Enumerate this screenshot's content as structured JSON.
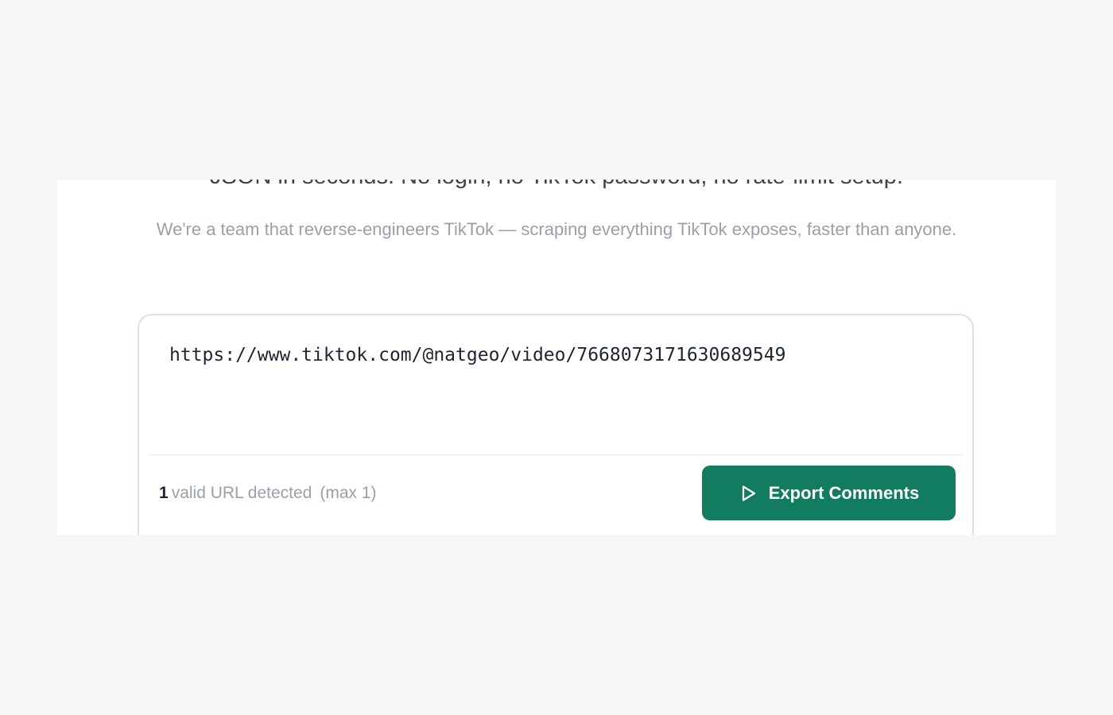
{
  "hero": {
    "headline": "JSON in seconds. No login, no TikTok password, no rate-limit setup.",
    "subtext": "We're a team that reverse-engineers TikTok — scraping everything TikTok exposes, faster than anyone."
  },
  "url_box": {
    "value": "https://www.tiktok.com/@natgeo/video/7668073171630689549"
  },
  "status": {
    "count": "1",
    "label": "valid URL detected",
    "max": "(max 1)"
  },
  "actions": {
    "export_label": "Export Comments",
    "export_icon": "play-icon",
    "accent_color": "#127c61"
  }
}
